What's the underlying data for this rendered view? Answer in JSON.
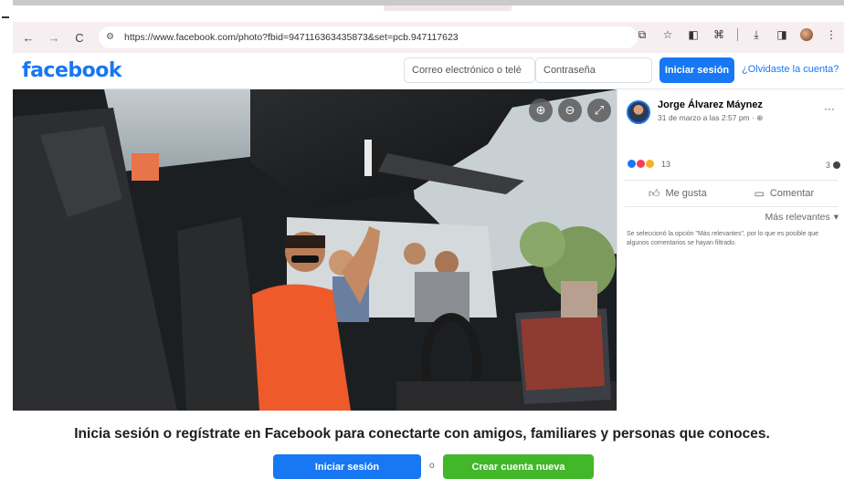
{
  "browser": {
    "url": "https://www.facebook.com/photo?fbid=947116363435873&set=pcb.947117623"
  },
  "header": {
    "logo": "facebook",
    "email_placeholder": "Correo electrónico o telé",
    "password_placeholder": "Contraseña",
    "login_label": "Iniciar sesión",
    "forgot_label": "¿Olvidaste la cuenta?"
  },
  "post": {
    "author": "Jorge Álvarez Máynez",
    "date": "31 de marzo a las 2:57 pm · ",
    "more": "···",
    "reactions_count": "13",
    "comments_count": "3",
    "like_label": "Me gusta",
    "comment_label": "Comentar",
    "sort_label": "Más relevantes",
    "filter_note": "Se seleccionó la opción \"Más relevantes\", por lo que es posible que algunos comentarios se hayan filtrado."
  },
  "footer": {
    "prompt": "Inicia sesión o regístrate en Facebook para conectarte con amigos, familiares y personas que conoces.",
    "login_label": "Iniciar sesión",
    "or_label": "o",
    "create_label": "Crear cuenta nueva"
  },
  "colors": {
    "brand": "#1877f2",
    "create": "#42b72a"
  }
}
